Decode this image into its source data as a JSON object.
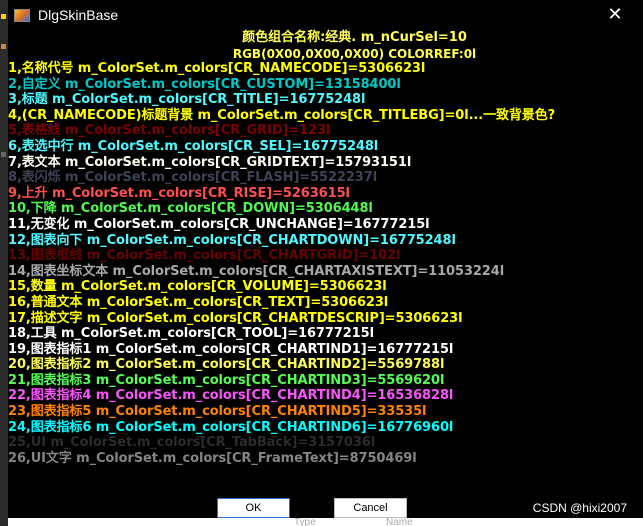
{
  "window": {
    "title": "DlgSkinBase",
    "close_glyph": "✕",
    "icon": "app-icon"
  },
  "header": {
    "line1": "颜色组合名称:经典. m_nCurSel=10",
    "line2": "RGB(0X00,0X00,0X00)  COLORREF:0l"
  },
  "color_rows": [
    {
      "text": "1,名称代号 m_ColorSet.m_colors[CR_NAMECODE]=5306623l",
      "color": "#ffff00"
    },
    {
      "text": "2,自定义 m_ColorSet.m_colors[CR_CUSTOM]=13158400l",
      "color": "#00c8c8"
    },
    {
      "text": "3,标题 m_ColorSet.m_colors[CR_TITLE]=16775248l",
      "color": "#50f8ff"
    },
    {
      "text": "4,(CR_NAMECODE)标题背景 m_ColorSet.m_colors[CR_TITLEBG]=0l...一致背景色?",
      "color": "#ffff00"
    },
    {
      "text": "5,表格线 m_ColorSet.m_colors[CR_GRID]=123l",
      "color": "#7b0000"
    },
    {
      "text": "6,表选中行 m_ColorSet.m_colors[CR_SEL]=16775248l",
      "color": "#50f8ff"
    },
    {
      "text": "7,表文本 m_ColorSet.m_colors[CR_GRIDTEXT]=15793151l",
      "color": "#fffcf0"
    },
    {
      "text": "8,表闪烁 m_ColorSet.m_colors[CR_FLASH]=5522237l",
      "color": "#3d4354"
    },
    {
      "text": "9,上升 m_ColorSet.m_colors[CR_RISE]=5263615l",
      "color": "#ff5050"
    },
    {
      "text": "10,下降 m_ColorSet.m_colors[CR_DOWN]=5306448l",
      "color": "#50f950"
    },
    {
      "text": "11,无变化 m_ColorSet.m_colors[CR_UNCHANGE]=16777215l",
      "color": "#ffffff"
    },
    {
      "text": "12,图表向下 m_ColorSet.m_colors[CR_CHARTDOWN]=16775248l",
      "color": "#50f8ff"
    },
    {
      "text": "13,图表框线 m_ColorSet.m_colors[CR_CHARTGRID]=102l",
      "color": "#660000"
    },
    {
      "text": "14,图表坐标文本 m_ColorSet.m_colors[CR_CHARTAXISTEXT]=11053224l",
      "color": "#a8a8a8"
    },
    {
      "text": "15,数量 m_ColorSet.m_colors[CR_VOLUME]=5306623l",
      "color": "#ffff00"
    },
    {
      "text": "16,普通文本 m_ColorSet.m_colors[CR_TEXT]=5306623l",
      "color": "#ffff00"
    },
    {
      "text": "17,描述文字 m_ColorSet.m_colors[CR_CHARTDESCRIP]=5306623l",
      "color": "#ffff00"
    },
    {
      "text": "18,工具 m_ColorSet.m_colors[CR_TOOL]=16777215l",
      "color": "#ffffff"
    },
    {
      "text": "19,图表指标1 m_ColorSet.m_colors[CR_CHARTIND1]=16777215l",
      "color": "#ffffff"
    },
    {
      "text": "20,图表指标2 m_ColorSet.m_colors[CR_CHARTIND2]=5569788l",
      "color": "#fcfc54"
    },
    {
      "text": "21,图表指标3 m_ColorSet.m_colors[CR_CHARTIND3]=5569620l",
      "color": "#54fc54"
    },
    {
      "text": "22,图表指标4 m_ColorSet.m_colors[CR_CHARTIND4]=16536828l",
      "color": "#fc54fc"
    },
    {
      "text": "23,图表指标5 m_ColorSet.m_colors[CR_CHARTIND5]=33535l",
      "color": "#ff8200"
    },
    {
      "text": "24,图表指标6 m_ColorSet.m_colors[CR_CHARTIND6]=16776960l",
      "color": "#00ffff"
    },
    {
      "text": "25,UI m_ColorSet.m_colors[CR_TabBack]=3157036l",
      "color": "#2c2c30"
    },
    {
      "text": "26,UI文字 m_ColorSet.m_colors[CR_FrameText]=8750469l",
      "color": "#858585"
    }
  ],
  "buttons": {
    "ok": "OK",
    "cancel": "Cancel"
  },
  "under_window": {
    "col1": "Type",
    "col2": "Name"
  },
  "watermark": "CSDN @hixi2007",
  "colors": {
    "dialog_bg": "#000000",
    "header_text": "#ffff55",
    "button_bg": "#ffffff",
    "ok_border": "#2b6fd6"
  }
}
